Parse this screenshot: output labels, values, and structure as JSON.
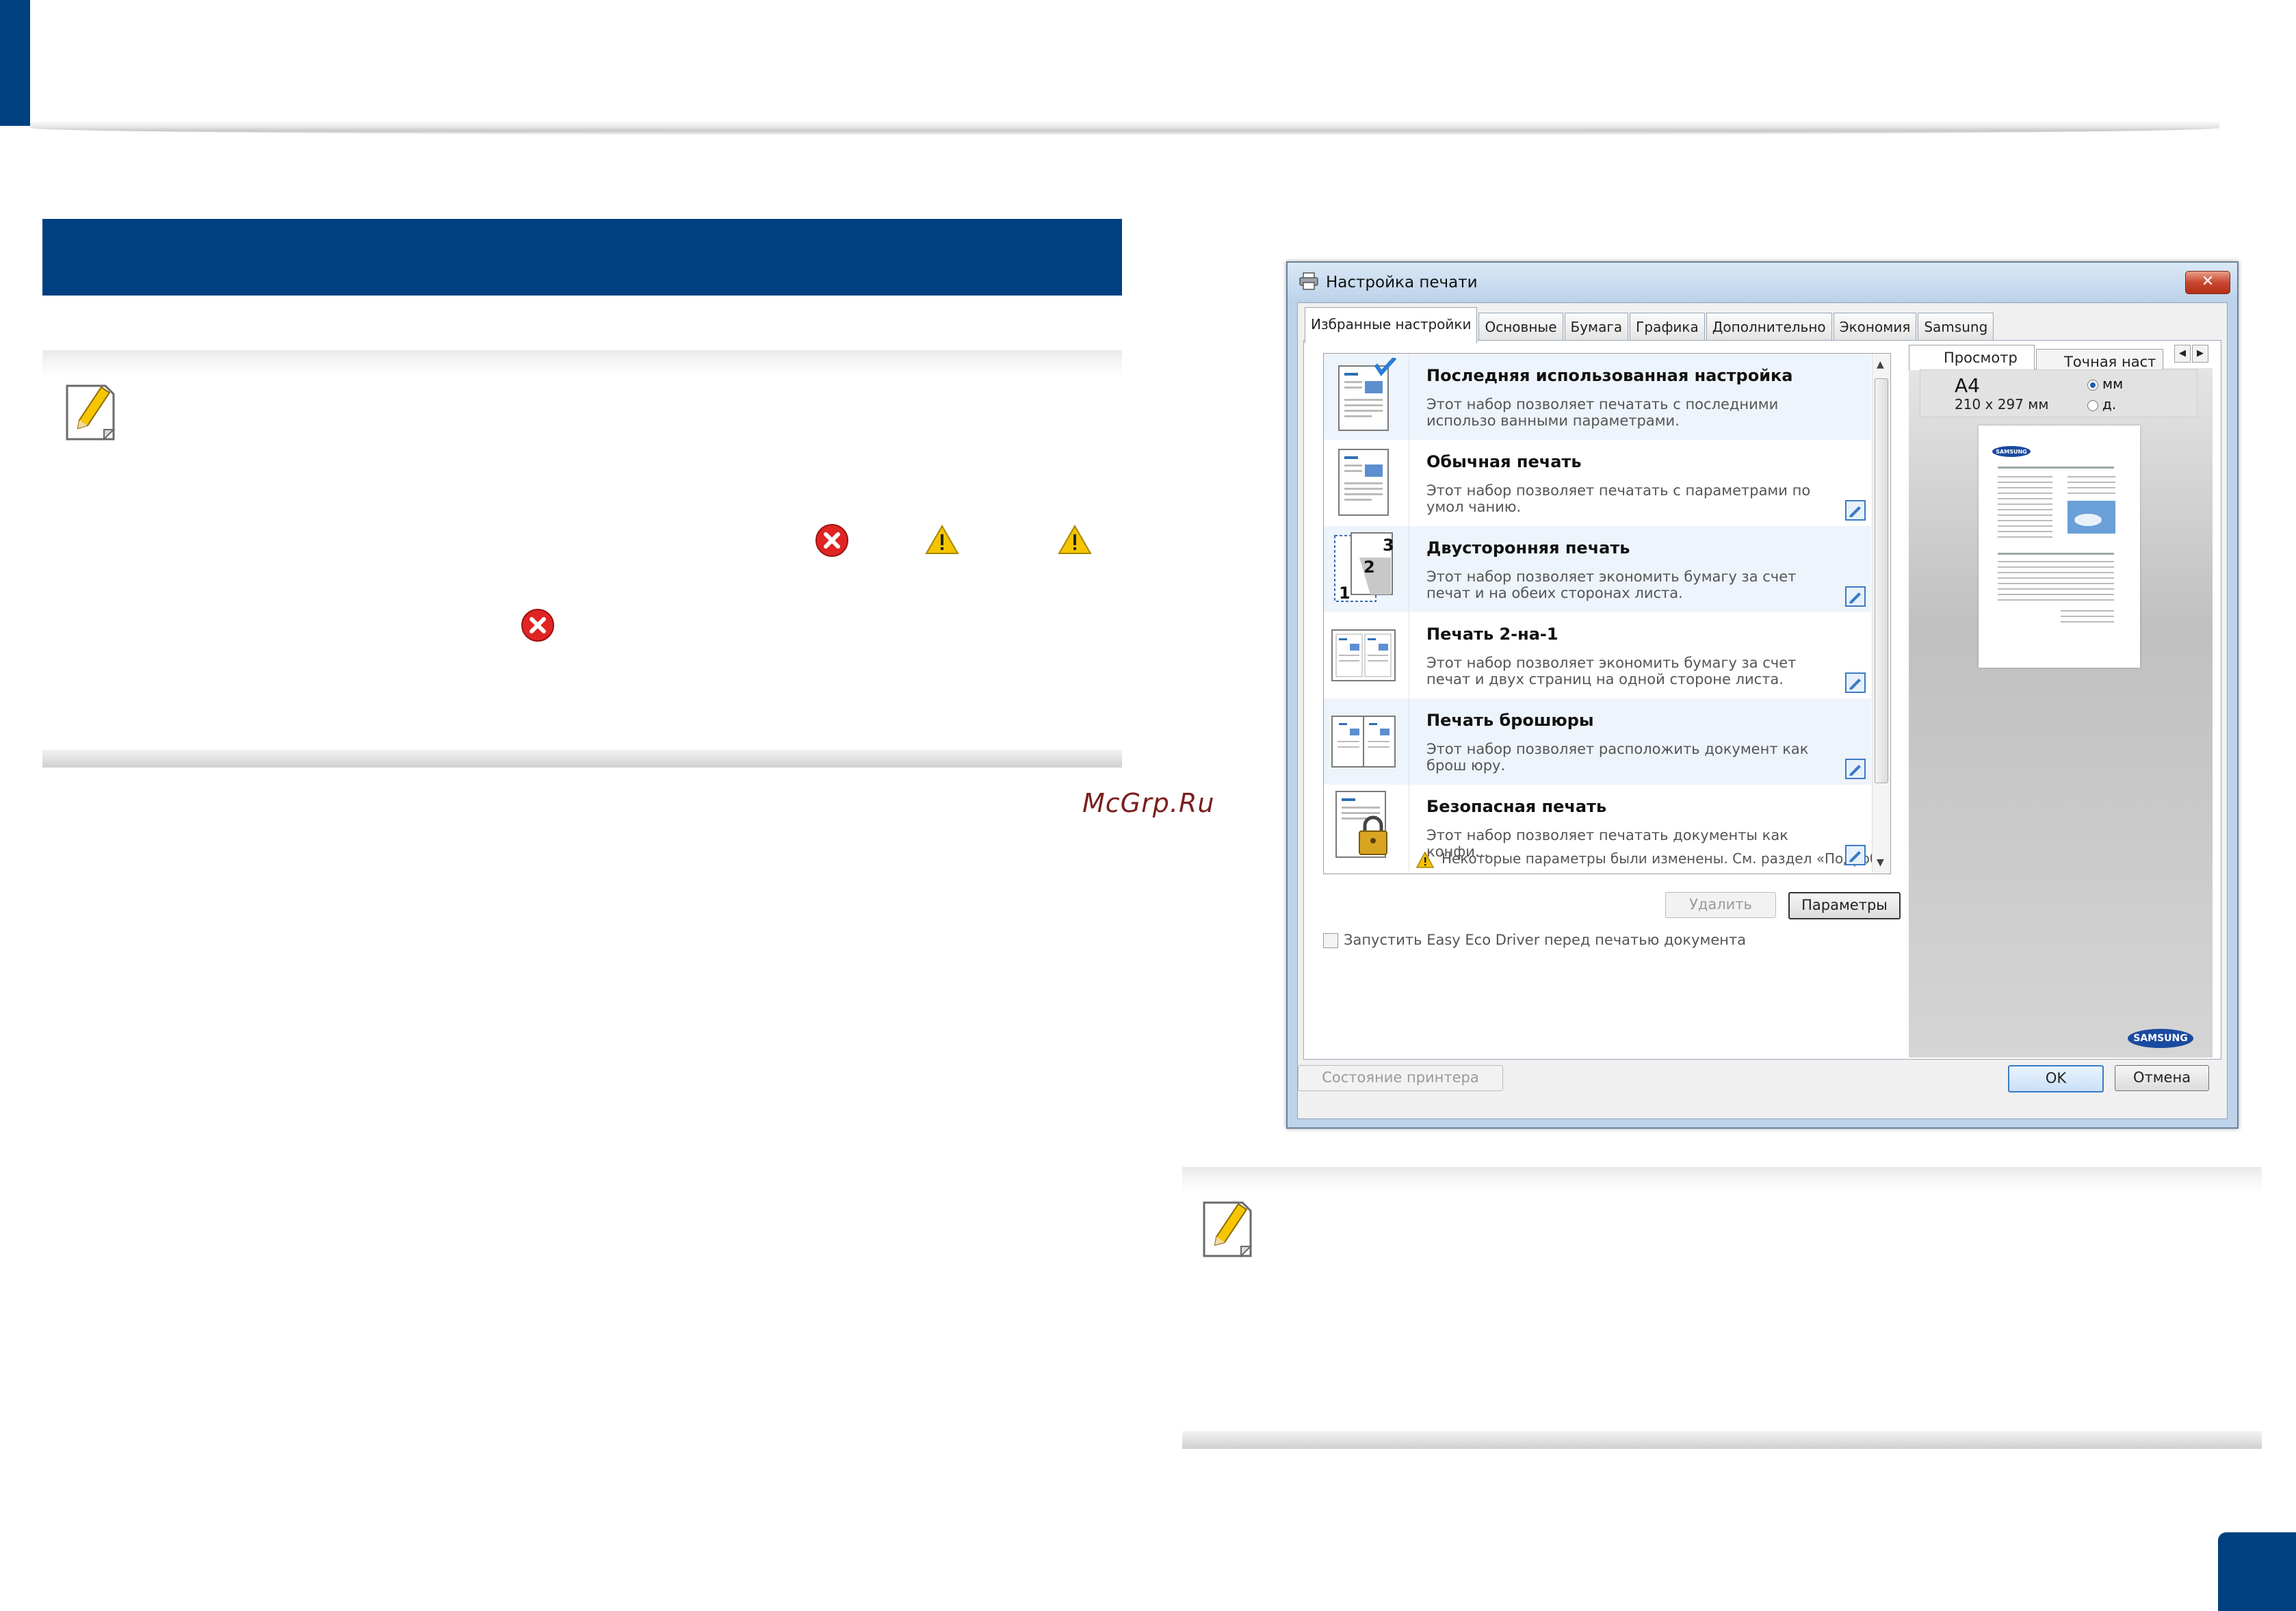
{
  "dialog": {
    "title": "Настройка печати",
    "close_glyph": "✕",
    "tabs": [
      "Избранные настройки",
      "Основные",
      "Бумага",
      "Графика",
      "Дополнительно",
      "Экономия",
      "Samsung"
    ],
    "presets": [
      {
        "title": "Последняя использованная настройка",
        "desc": "Этот набор позволяет печатать с последними использо ванными параметрами."
      },
      {
        "title": "Обычная печать",
        "desc": "Этот набор позволяет печатать с параметрами по умол чанию."
      },
      {
        "title": "Двусторонняя печать",
        "desc": "Этот набор позволяет экономить бумагу за счет печат и на обеих сторонах листа."
      },
      {
        "title": "Печать 2-на-1",
        "desc": "Этот набор позволяет экономить бумагу за счет печат и двух страниц на одной стороне листа."
      },
      {
        "title": "Печать брошюры",
        "desc": "Этот набор позволяет расположить документ как брош юру."
      },
      {
        "title": "Безопасная печать",
        "desc": "Этот набор позволяет печатать документы как конфи...",
        "warning": "Некоторые параметры были изменены. См. раздел «Подробне..."
      }
    ],
    "duplex_page_numbers": [
      "3",
      "2",
      "1"
    ],
    "delete_button": "Удалить",
    "params_button": "Параметры",
    "eco_checkbox_label": "Запустить Easy Eco Driver перед печатью документа",
    "preview_tabs": [
      "Просмотр",
      "Точная наст"
    ],
    "paper_name": "A4",
    "paper_size": "210 x 297 мм",
    "unit_mm": "мм",
    "unit_inch": "д.",
    "preview_logo_text": "SAMSUNG",
    "logo_text": "SAMSUNG",
    "printer_status_button": "Состояние принтера",
    "ok_button": "OK",
    "cancel_button": "Отмена"
  },
  "watermark": "McGrp.Ru",
  "colors": {
    "brand_blue": "#004080",
    "window_frame": "#bcd3ea",
    "error_red": "#e02424",
    "warning_yellow": "#f5c400"
  }
}
